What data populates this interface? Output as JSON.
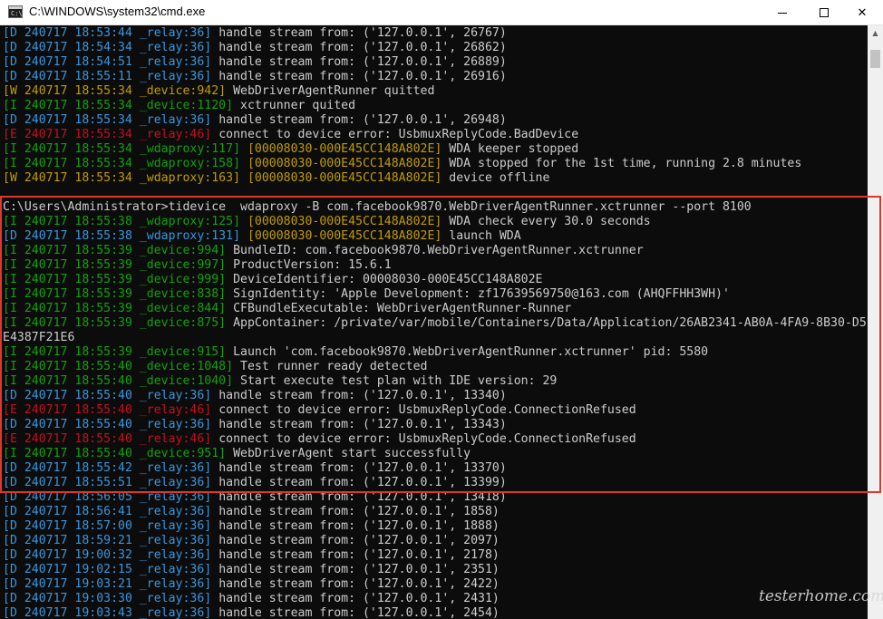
{
  "window": {
    "title": "C:\\WINDOWS\\system32\\cmd.exe",
    "icon": "cmd-icon",
    "controls": {
      "minimize": "minimize-icon",
      "maximize": "maximize-icon",
      "close": "✕"
    }
  },
  "colors": {
    "debug": "#3a96dd",
    "info": "#13a10e",
    "warn": "#c19c00",
    "error": "#c50f1f",
    "text": "#cccccc",
    "highlight": "#e0362c",
    "background": "#0c0c0c"
  },
  "console": {
    "lines": [
      {
        "level": "D",
        "prefix": "[D 240717 18:53:44 _relay:36]",
        "message": " handle stream from: ('127.0.0.1', 26767)"
      },
      {
        "level": "D",
        "prefix": "[D 240717 18:54:34 _relay:36]",
        "message": " handle stream from: ('127.0.0.1', 26862)"
      },
      {
        "level": "D",
        "prefix": "[D 240717 18:54:51 _relay:36]",
        "message": " handle stream from: ('127.0.0.1', 26889)"
      },
      {
        "level": "D",
        "prefix": "[D 240717 18:55:11 _relay:36]",
        "message": " handle stream from: ('127.0.0.1', 26916)"
      },
      {
        "level": "W",
        "prefix": "[W 240717 18:55:34 _device:942]",
        "message": " WebDriverAgentRunner quitted"
      },
      {
        "level": "I",
        "prefix": "[I 240717 18:55:34 _device:1120]",
        "message": " xctrunner quited"
      },
      {
        "level": "D",
        "prefix": "[D 240717 18:55:34 _relay:36]",
        "message": " handle stream from: ('127.0.0.1', 26948)"
      },
      {
        "level": "E",
        "prefix": "[E 240717 18:55:34 _relay:46]",
        "message": " connect to device error: UsbmuxReplyCode.BadDevice"
      },
      {
        "level": "I",
        "prefix": "[I 240717 18:55:34 _wdaproxy:117]",
        "tag": " [00008030-000E45CC148A802E]",
        "message": " WDA keeper stopped"
      },
      {
        "level": "I",
        "prefix": "[I 240717 18:55:34 _wdaproxy:158]",
        "tag": " [00008030-000E45CC148A802E]",
        "message": " WDA stopped for the 1st time, running 2.8 minutes"
      },
      {
        "level": "W",
        "prefix": "[W 240717 18:55:34 _wdaproxy:163]",
        "tag": " [00008030-000E45CC148A802E]",
        "message": " device offline"
      },
      {
        "level": "blank",
        "prefix": "",
        "message": ""
      },
      {
        "level": "prompt",
        "prefix": "",
        "message": "C:\\Users\\Administrator>tidevice  wdaproxy -B com.facebook9870.WebDriverAgentRunner.xctrunner --port 8100"
      },
      {
        "level": "I",
        "prefix": "[I 240717 18:55:38 _wdaproxy:125]",
        "tag": " [00008030-000E45CC148A802E]",
        "message": " WDA check every 30.0 seconds"
      },
      {
        "level": "D",
        "prefix": "[D 240717 18:55:38 _wdaproxy:131]",
        "tag": " [00008030-000E45CC148A802E]",
        "message": " launch WDA"
      },
      {
        "level": "I",
        "prefix": "[I 240717 18:55:39 _device:994]",
        "message": " BundleID: com.facebook9870.WebDriverAgentRunner.xctrunner"
      },
      {
        "level": "I",
        "prefix": "[I 240717 18:55:39 _device:997]",
        "message": " ProductVersion: 15.6.1"
      },
      {
        "level": "I",
        "prefix": "[I 240717 18:55:39 _device:999]",
        "message": " DeviceIdentifier: 00008030-000E45CC148A802E"
      },
      {
        "level": "I",
        "prefix": "[I 240717 18:55:39 _device:838]",
        "message": " SignIdentity: 'Apple Development: zf17639569750@163.com (AHQFFHH3WH)'"
      },
      {
        "level": "I",
        "prefix": "[I 240717 18:55:39 _device:844]",
        "message": " CFBundleExecutable: WebDriverAgentRunner-Runner"
      },
      {
        "level": "I",
        "prefix": "[I 240717 18:55:39 _device:875]",
        "message": " AppContainer: /private/var/mobile/Containers/Data/Application/26AB2341-AB0A-4FA9-8B30-D5"
      },
      {
        "level": "cont",
        "prefix": "",
        "message": "E4387F21E6"
      },
      {
        "level": "I",
        "prefix": "[I 240717 18:55:39 _device:915]",
        "message": " Launch 'com.facebook9870.WebDriverAgentRunner.xctrunner' pid: 5580"
      },
      {
        "level": "I",
        "prefix": "[I 240717 18:55:40 _device:1048]",
        "message": " Test runner ready detected"
      },
      {
        "level": "I",
        "prefix": "[I 240717 18:55:40 _device:1040]",
        "message": " Start execute test plan with IDE version: 29"
      },
      {
        "level": "D",
        "prefix": "[D 240717 18:55:40 _relay:36]",
        "message": " handle stream from: ('127.0.0.1', 13340)"
      },
      {
        "level": "E",
        "prefix": "[E 240717 18:55:40 _relay:46]",
        "message": " connect to device error: UsbmuxReplyCode.ConnectionRefused"
      },
      {
        "level": "D",
        "prefix": "[D 240717 18:55:40 _relay:36]",
        "message": " handle stream from: ('127.0.0.1', 13343)"
      },
      {
        "level": "E",
        "prefix": "[E 240717 18:55:40 _relay:46]",
        "message": " connect to device error: UsbmuxReplyCode.ConnectionRefused"
      },
      {
        "level": "I",
        "prefix": "[I 240717 18:55:40 _device:951]",
        "message": " WebDriverAgent start successfully"
      },
      {
        "level": "D",
        "prefix": "[D 240717 18:55:42 _relay:36]",
        "message": " handle stream from: ('127.0.0.1', 13370)"
      },
      {
        "level": "D",
        "prefix": "[D 240717 18:55:51 _relay:36]",
        "message": " handle stream from: ('127.0.0.1', 13399)"
      },
      {
        "level": "D",
        "prefix": "[D 240717 18:56:05 _relay:36]",
        "message": " handle stream from: ('127.0.0.1', 13418)"
      },
      {
        "level": "D",
        "prefix": "[D 240717 18:56:41 _relay:36]",
        "message": " handle stream from: ('127.0.0.1', 1858)"
      },
      {
        "level": "D",
        "prefix": "[D 240717 18:57:00 _relay:36]",
        "message": " handle stream from: ('127.0.0.1', 1888)"
      },
      {
        "level": "D",
        "prefix": "[D 240717 18:59:21 _relay:36]",
        "message": " handle stream from: ('127.0.0.1', 2097)"
      },
      {
        "level": "D",
        "prefix": "[D 240717 19:00:32 _relay:36]",
        "message": " handle stream from: ('127.0.0.1', 2178)"
      },
      {
        "level": "D",
        "prefix": "[D 240717 19:02:15 _relay:36]",
        "message": " handle stream from: ('127.0.0.1', 2351)"
      },
      {
        "level": "D",
        "prefix": "[D 240717 19:03:21 _relay:36]",
        "message": " handle stream from: ('127.0.0.1', 2422)"
      },
      {
        "level": "D",
        "prefix": "[D 240717 19:03:30 _relay:36]",
        "message": " handle stream from: ('127.0.0.1', 2431)"
      },
      {
        "level": "D",
        "prefix": "[D 240717 19:03:43 _relay:36]",
        "message": " handle stream from: ('127.0.0.1', 2454)"
      }
    ]
  },
  "watermark": "testerhome.com"
}
